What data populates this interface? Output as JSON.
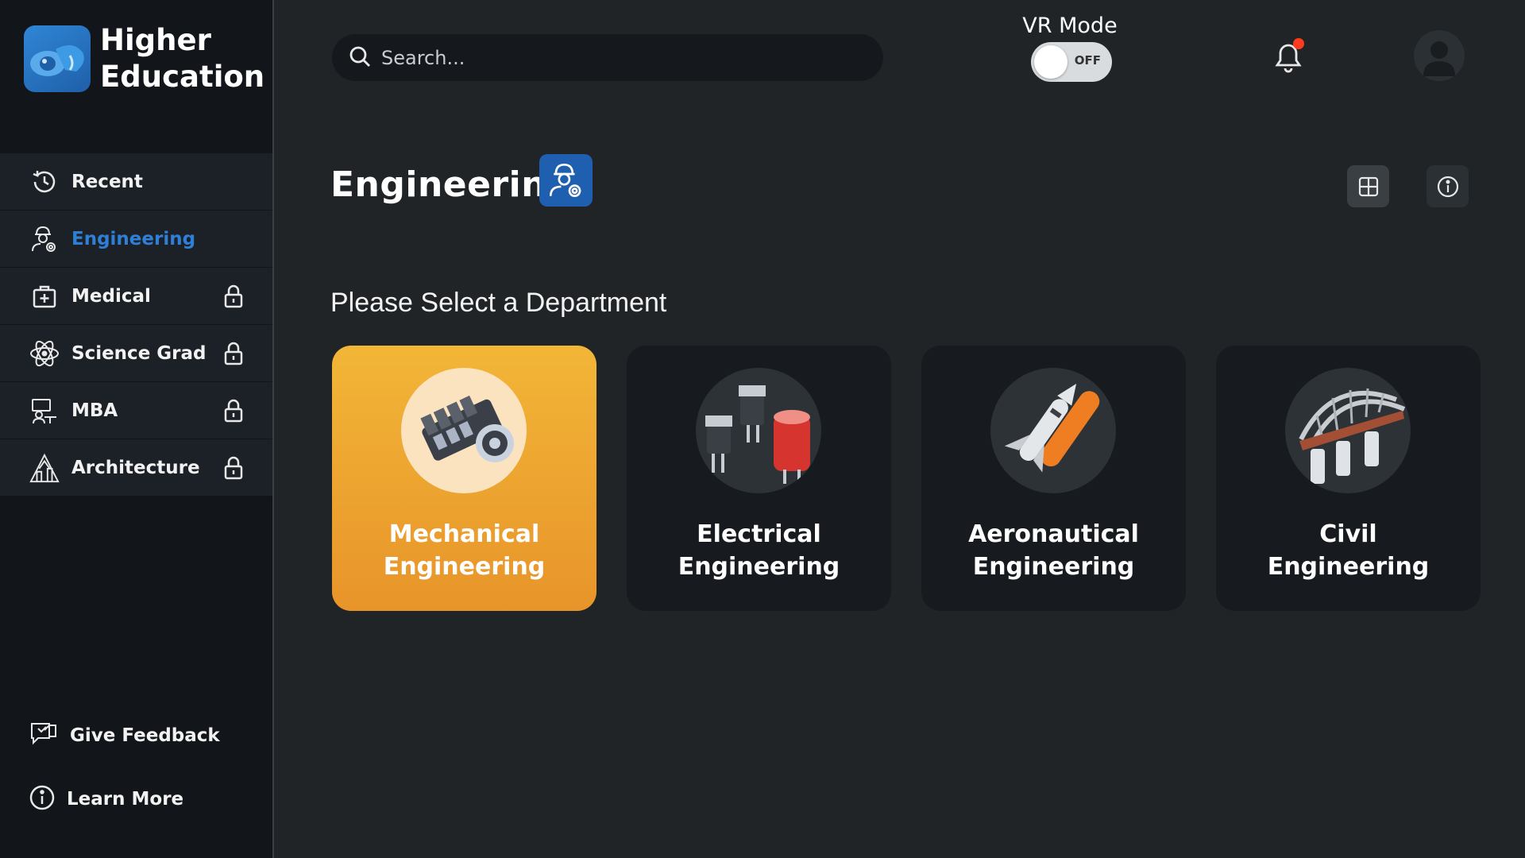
{
  "brand": {
    "line1": "Higher",
    "line2": "Education"
  },
  "sidebar": {
    "items": [
      {
        "label": "Recent"
      },
      {
        "label": "Engineering"
      },
      {
        "label": "Medical"
      },
      {
        "label": "Science Grad"
      },
      {
        "label": "MBA"
      },
      {
        "label": "Architecture"
      }
    ],
    "bottom": [
      {
        "label": "Give Feedback"
      },
      {
        "label": "Learn More"
      }
    ]
  },
  "search": {
    "placeholder": "Search..."
  },
  "vr_mode": {
    "label": "VR Mode",
    "state": "OFF"
  },
  "page": {
    "title": "Engineering",
    "subtitle": "Please Select a Department"
  },
  "departments": [
    {
      "line1": "Mechanical",
      "line2": "Engineering"
    },
    {
      "line1": "Electrical",
      "line2": "Engineering"
    },
    {
      "line1": "Aeronautical",
      "line2": "Engineering"
    },
    {
      "line1": "Civil",
      "line2": "Engineering"
    }
  ],
  "colors": {
    "accent": "#2f7fd6",
    "selected_card": "#f2b637",
    "notification": "#ff3b1f"
  }
}
